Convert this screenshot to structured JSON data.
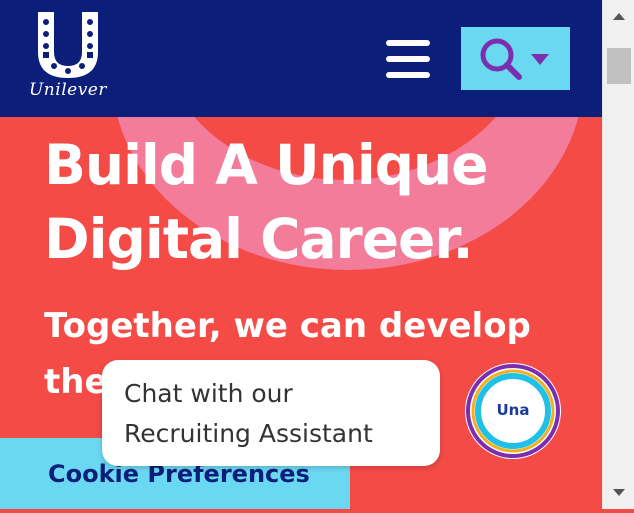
{
  "brand": {
    "name": "Unilever"
  },
  "header": {
    "menu_icon": "hamburger-menu-icon",
    "search_icon": "search-icon",
    "dropdown_icon": "caret-down-icon"
  },
  "hero": {
    "title": "Build A Unique Digital Career.",
    "subtitle": "Together, we can develop the ... every day"
  },
  "chat": {
    "prompt": "Chat with our Recruiting Assistant",
    "assistant_name": "Una"
  },
  "cookie": {
    "label": "Cookie Preferences"
  },
  "colors": {
    "navy": "#0b1f7a",
    "coral": "#f44b47",
    "pink": "#f27c9a",
    "cyan": "#6bd8f2",
    "white": "#ffffff"
  }
}
